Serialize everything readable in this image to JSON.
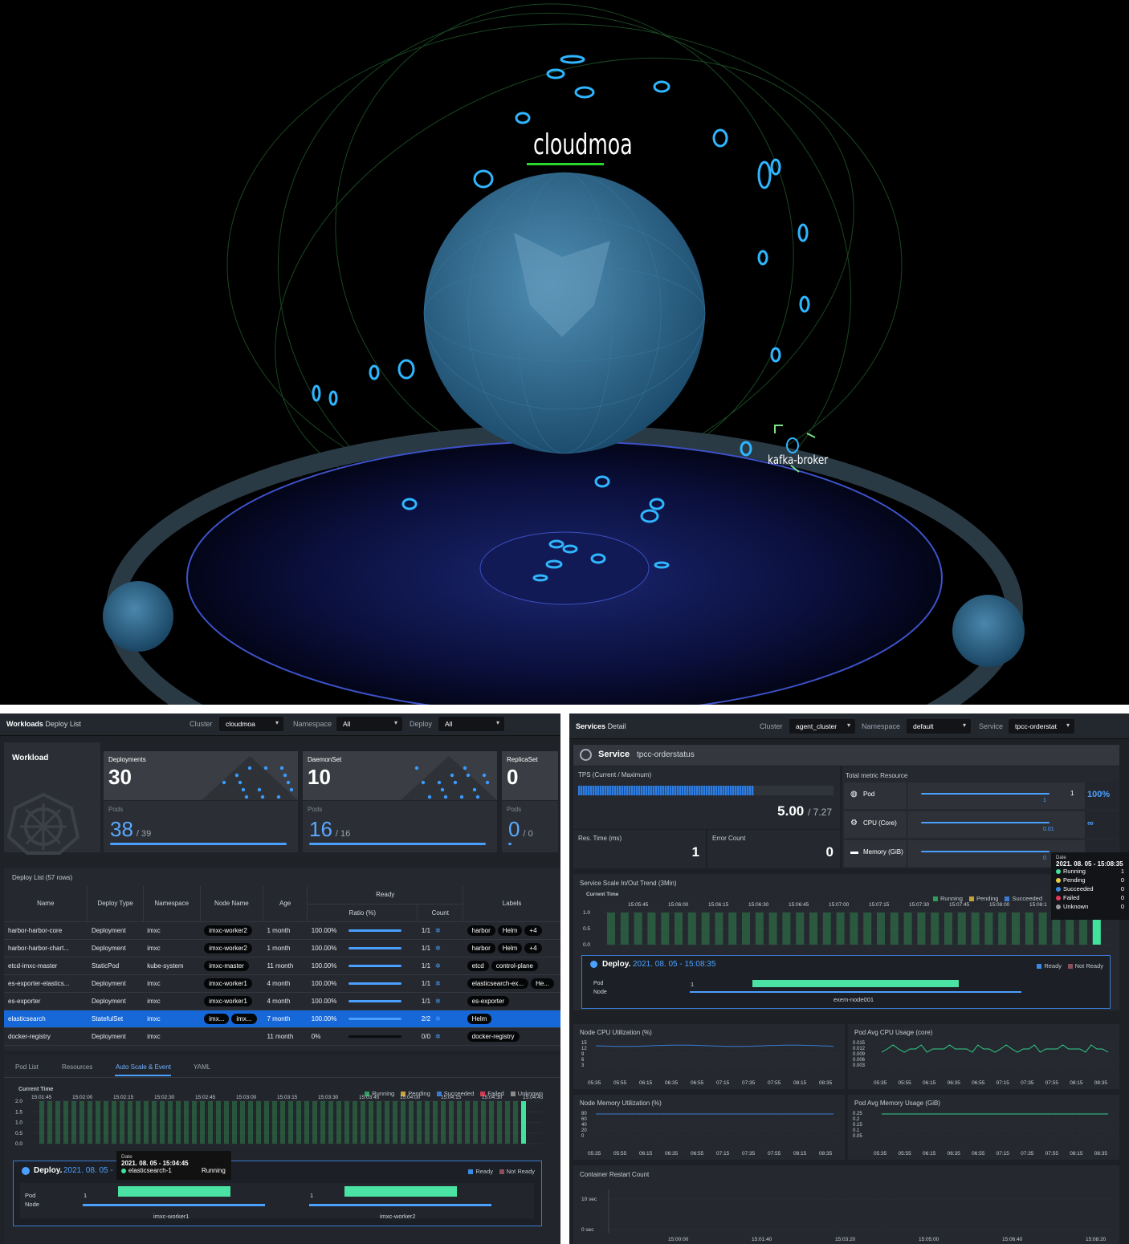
{
  "hero": {
    "brand": "cloudmoa",
    "node_label": "kafka-broker"
  },
  "workloads": {
    "title_bold": "Workloads",
    "title_rest": "Deploy List",
    "cluster_label": "Cluster",
    "cluster_value": "cloudmoa",
    "namespace_label": "Namespace",
    "namespace_value": "All",
    "deploy_label": "Deploy",
    "deploy_value": "All",
    "summary_title": "Workload",
    "cards": [
      {
        "label": "Deployments",
        "count": "30",
        "pods_label": "Pods",
        "pods_cur": "38",
        "pods_total": "/ 39"
      },
      {
        "label": "DaemonSet",
        "count": "10",
        "pods_label": "Pods",
        "pods_cur": "16",
        "pods_total": "/ 16"
      },
      {
        "label": "ReplicaSet",
        "count": "0",
        "pods_label": "Pods",
        "pods_cur": "0",
        "pods_total": "/ 0"
      }
    ],
    "list_title": "Deploy List (57 rows)",
    "columns": {
      "name": "Name",
      "type": "Deploy Type",
      "ns": "Namespace",
      "node": "Node Name",
      "age": "Age",
      "ready": "Ready",
      "ratio": "Ratio (%)",
      "count": "Count",
      "labels": "Labels"
    },
    "rows": [
      {
        "name": "harbor-harbor-core",
        "type": "Deployment",
        "ns": "imxc",
        "nodes": [
          "imxc-worker2"
        ],
        "age": "1 month",
        "ratio": "100.00%",
        "ratio_val": 1,
        "count": "1/1",
        "labels": [
          "harbor",
          "Helm",
          "+4"
        ]
      },
      {
        "name": "harbor-harbor-chart...",
        "type": "Deployment",
        "ns": "imxc",
        "nodes": [
          "imxc-worker2"
        ],
        "age": "1 month",
        "ratio": "100.00%",
        "ratio_val": 1,
        "count": "1/1",
        "labels": [
          "harbor",
          "Helm",
          "+4"
        ]
      },
      {
        "name": "etcd-imxc-master",
        "type": "StaticPod",
        "ns": "kube-system",
        "nodes": [
          "imxc-master"
        ],
        "age": "11 month",
        "ratio": "100.00%",
        "ratio_val": 1,
        "count": "1/1",
        "labels": [
          "etcd",
          "control-plane"
        ]
      },
      {
        "name": "es-exporter-elastics...",
        "type": "Deployment",
        "ns": "imxc",
        "nodes": [
          "imxc-worker1"
        ],
        "age": "4 month",
        "ratio": "100.00%",
        "ratio_val": 1,
        "count": "1/1",
        "labels": [
          "elasticsearch-ex...",
          "He..."
        ]
      },
      {
        "name": "es-exporter",
        "type": "Deployment",
        "ns": "imxc",
        "nodes": [
          "imxc-worker1"
        ],
        "age": "4 month",
        "ratio": "100.00%",
        "ratio_val": 1,
        "count": "1/1",
        "labels": [
          "es-exporter"
        ]
      },
      {
        "name": "elasticsearch",
        "type": "StatefulSet",
        "ns": "imxc",
        "nodes": [
          "imx...",
          "imx..."
        ],
        "age": "7 month",
        "ratio": "100.00%",
        "ratio_val": 1,
        "count": "2/2",
        "labels": [
          "Helm"
        ]
      },
      {
        "name": "docker-registry",
        "type": "Deployment",
        "ns": "imxc",
        "nodes": [],
        "age": "11 month",
        "ratio": "0%",
        "ratio_val": 0,
        "count": "0/0",
        "labels": [
          "docker-registry"
        ]
      }
    ],
    "tabs": [
      "Pod List",
      "Resources",
      "Auto Scale & Event",
      "YAML"
    ],
    "current_time": "Current Time",
    "legend": [
      {
        "label": "Running",
        "color": "#2e9d5c"
      },
      {
        "label": "Pending",
        "color": "#c6a23a"
      },
      {
        "label": "Succeeded",
        "color": "#3a7ad1"
      },
      {
        "label": "Failed",
        "color": "#d13a52"
      },
      {
        "label": "Unknown",
        "color": "#8a8a8a"
      }
    ],
    "times": [
      "15:01:45",
      "15:02:00",
      "15:02:15",
      "15:02:30",
      "15:02:45",
      "15:03:00",
      "15:03:15",
      "15:03:30",
      "15:03:45",
      "15:04:00",
      "15:04:15",
      "15:04:30",
      "15:04:45"
    ],
    "yticks": [
      "2.0",
      "1.5",
      "1.0",
      "0.5",
      "0.0"
    ],
    "tooltip": {
      "date_label": "Date",
      "date": "2021. 08. 05 - 15:04:45",
      "pod": "elasticsearch-1",
      "status": "Running"
    },
    "deploy_title": "Deploy.",
    "deploy_date": "2021. 08. 05 -",
    "ready": "Ready",
    "not_ready": "Not Ready",
    "pod_label": "Pod",
    "node_label": "Node",
    "pod_count1": "1",
    "pod_count2": "1",
    "node1": "imxc-worker1",
    "node2": "imxc-worker2"
  },
  "services": {
    "title_bold": "Services",
    "title_rest": "Detail",
    "cluster_label": "Cluster",
    "cluster_value": "agent_cluster",
    "namespace_label": "Namespace",
    "namespace_value": "default",
    "service_label": "Service",
    "service_value": "tpcc-orderstat",
    "service_prefix": "Service",
    "service_name": "tpcc-orderstatus",
    "tps_label": "TPS (Current / Maximum)",
    "tps_cur": "5.00",
    "tps_max": "/ 7.27",
    "tps_fill": 0.69,
    "res_label": "Res. Time (ms)",
    "res_val": "1",
    "err_label": "Error Count",
    "err_val": "0",
    "total_label": "Total metric Resource",
    "metrics": [
      {
        "label": "Pod",
        "val": "1",
        "sub": "1",
        "pct": "100%",
        "fill": 1
      },
      {
        "label": "CPU (Core)",
        "val": "",
        "sub": "0.01",
        "pct": "∞",
        "fill": 1
      },
      {
        "label": "Memory (GiB)",
        "val": "",
        "sub": "0",
        "pct": "",
        "fill": 1
      }
    ],
    "scale_title": "Service Scale In/Out Trend (3Min)",
    "current_time": "Current Time",
    "legend": [
      {
        "label": "Running",
        "color": "#2e9d5c"
      },
      {
        "label": "Pending",
        "color": "#c6a23a"
      },
      {
        "label": "Succeeded",
        "color": "#3a7ad1"
      }
    ],
    "times": [
      "15:05:45",
      "15:06:00",
      "15:06:15",
      "15:06:30",
      "15:06:45",
      "15:07:00",
      "15:07:15",
      "15:07:30",
      "15:07:45",
      "15:08:00",
      "15:08:1"
    ],
    "yticks": [
      "1.0",
      "0.5",
      "0.0"
    ],
    "tooltip": {
      "date_label": "Date",
      "date": "2021. 08. 05 - 15:08:35",
      "rows": [
        {
          "label": "Running",
          "val": "1",
          "color": "#40e39b"
        },
        {
          "label": "Pending",
          "val": "0",
          "color": "#e4d040"
        },
        {
          "label": "Succeeded",
          "val": "0",
          "color": "#3a8ae6"
        },
        {
          "label": "Failed",
          "val": "0",
          "color": "#e63a5a"
        },
        {
          "label": "Unknown",
          "val": "0",
          "color": "#9a9a9a"
        }
      ]
    },
    "deploy_title": "Deploy.",
    "deploy_date": "2021. 08. 05 - 15:08:35",
    "ready": "Ready",
    "not_ready": "Not Ready",
    "pod_label": "Pod",
    "node_label": "Node",
    "pod_count": "1",
    "node_name": "exem-node001",
    "mini_times": [
      "05:35",
      "05:55",
      "06:15",
      "06:35",
      "06:55",
      "07:15",
      "07:35",
      "07:55",
      "08:15",
      "08:35"
    ],
    "charts": [
      {
        "title": "Node CPU Utilization (%)",
        "yticks": [
          "15",
          "12",
          "9",
          "6",
          "3"
        ],
        "color": "#3a7ad1"
      },
      {
        "title": "Pod Avg CPU Usage (core)",
        "yticks": [
          "0.015",
          "0.012",
          "0.009",
          "0.006",
          "0.003"
        ],
        "color": "#2fcf88"
      },
      {
        "title": "Node Memory Utilization (%)",
        "yticks": [
          "80",
          "60",
          "40",
          "20",
          "0"
        ],
        "color": "#3a7ad1"
      },
      {
        "title": "Pod Avg Memory Usage (GiB)",
        "yticks": [
          "0.25",
          "0.2",
          "0.15",
          "0.1",
          "0.05"
        ],
        "color": "#2fcf88"
      }
    ],
    "restart_title": "Container Restart Count",
    "restart_y": [
      "10 sec",
      "0 sec"
    ],
    "restart_times": [
      "15:00:00",
      "15:01:40",
      "15:03:20",
      "15:05:00",
      "15:06:40",
      "15:08:20"
    ]
  }
}
